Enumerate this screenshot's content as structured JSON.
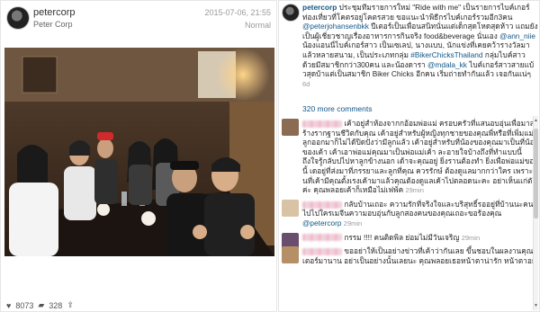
{
  "post": {
    "username": "petercorp",
    "display_name": "Peter Corp",
    "date": "2015-07-06, 21:55",
    "filter": "Normal",
    "likes": "8073",
    "comments_count": "328",
    "icons": {
      "like": "heart-icon",
      "comment": "comment-icon",
      "share": "share-icon"
    }
  },
  "caption": {
    "username": "petercorp",
    "part1": " ประชุมทีมรายการใหม่ \"Ride with me\" เป็นรายการไบค์เกอร์ท่องเที่ยวที่โคตรอยู่โคตรสวย ขอแนะนำพิธีกรไบค์เกอร์รวมอีก3คน ",
    "mention1": "@peterjohansenbkk",
    "part2": " ปีเตอร์เป็นเพื่อนสนิทนั่นแต่เด็กสุดโหดสุดห้าว แถมยังเป็นผู้เชี่ยวชาญเรื่องอาหารการกินจริง food&beverage นั่นเอง ",
    "mention2": "@ann_niie",
    "part3": " น้องแอนนี่ไบค์เกอร์สาว เป็นเซเลป, นางแบบ, นักแข่งที่เคยคว้ารางวัลมาแล้วหลายสนาม, เป็นประเภทกลุ่ม ",
    "tag": "#BikerChicksThailand",
    "part4": " กลุ่มไบค์สาวด้วยมีสมาชิกกว่า300คน และน้องดารา ",
    "mention3": "@mdala_kk",
    "part5": " ไบค์เกอร์สาวสายแบ้วสุดบ้าแต่เป็นสมาชิก Biker Chicks อีกคน เริ่มถ่ายทำกันแล้ว เจอกันแน่ๆ ",
    "time_ago": "6d"
  },
  "more_comments": "320 more comments",
  "comments": [
    {
      "text": "เค้าอยู่สำห้องจากกอ้อมพ่อแม่ ครอบครัวที่แสนอบอุ่นเพื่อมาสร้างรากฐานชีวิตกับคุณ เค้าอยู่สำหรับผู้หญิงทุกชายของคุณพี่หรือที่เพิ่มแม่ลูกออกมาก็ไม่ได้ปิดปังว่ามีลูกแล้ว เค้าอยู่สำหรับที่น้องของคุณมาเป็นที่น้องของเค้า เค้าเอาพ่อแม่คุณมาเป็นพ่อแม่เค้า ละอายใจบ้างถึงที่ทำแบบนี้ ถึงใจรู้กลับปไปหาลูกข้างนอก เด้าจะคุณอยู่ ยิ่งรานต้องทำ ยิ่งเพื่อพ่อแม่ของนี้ เดอยู่ที่ส่งมาที่ภรรยาและลูกที่คุณ ควรรักษ์ ต้องดูแลมากกว่าใคร เพราะทั้นที่เค้ามีคุณตั้งเรงเค้ามาแล้วคุณต้องดูแลเค้าไปตลอดนะคะ อย่าเห็นแก่ตัวค่ะ คุณพลอยเค้าก็เหมือไม่เฟพ้ค",
      "time_ago": "29min",
      "avatar": "#8b6b52"
    },
    {
      "text": "กลับบ้านเถอะ ความรักที่จริงใจและบริสุทธิ์รออยู่ที่บ้านนะคนไปไปใครเมจีนความอบอุ่นกับลูกสองคนของคุณเถอะขอร้องคุณ ",
      "mention": "@petercorp",
      "time_ago": "29min",
      "avatar": "#d8c3a5"
    },
    {
      "text": "กรรม !!!! คนติดพิล ย่อมไม่มีวันเจริญ",
      "time_ago": "29min",
      "avatar": "#6a4e6e"
    },
    {
      "text": "ขออย่าให้เป็นอย่างข่าวที่เค้าว่ากันเลย ขึ้นชอบในผลงานคุณปีเตอร์มานาน อย่าเป็นอย่างนั้นเลยนะ คุณพลอยเธอหน้าตาน่ารัก หน้าตาอยู่",
      "time_ago": "",
      "avatar": "#b58f66"
    }
  ],
  "colors": {
    "link": "#125688",
    "muted": "#999999",
    "border": "#e6e6e6"
  }
}
